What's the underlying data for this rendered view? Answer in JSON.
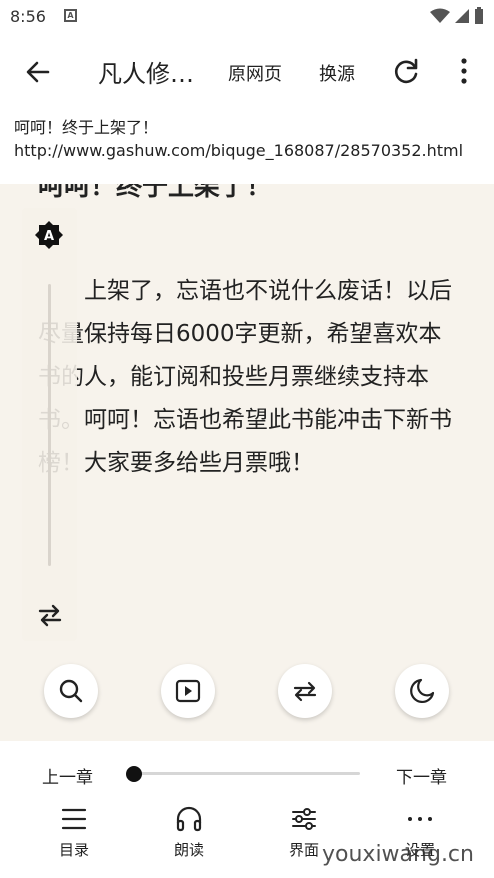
{
  "status_bar": {
    "time": "8:56",
    "notification": "A"
  },
  "toolbar": {
    "title": "凡人修…",
    "original_page": "原网页",
    "change_source": "换源"
  },
  "chapter": {
    "title": "呵呵！终于上架了！",
    "url": "http://www.gashuw.com/biquge_168087/28570352.html",
    "heading": "呵呵！终于上架了！",
    "body": "上架了，忘语也不说什么废话！以后尽量保持每日6000字更新，希望喜欢本书的人，能订阅和投些月票继续支持本书。呵呵！忘语也希望此书能冲击下新书榜！大家要多给些月票哦！"
  },
  "brightness": {
    "auto_label": "A",
    "level": 0.0
  },
  "navigation": {
    "prev_chapter": "上一章",
    "next_chapter": "下一章",
    "progress": 0.0
  },
  "bottom_nav": [
    {
      "label": "目录",
      "icon": "menu-icon"
    },
    {
      "label": "朗读",
      "icon": "headphones-icon"
    },
    {
      "label": "界面",
      "icon": "sliders-icon"
    },
    {
      "label": "设置",
      "icon": "more-icon"
    }
  ],
  "watermark": "youxiwang.cn"
}
